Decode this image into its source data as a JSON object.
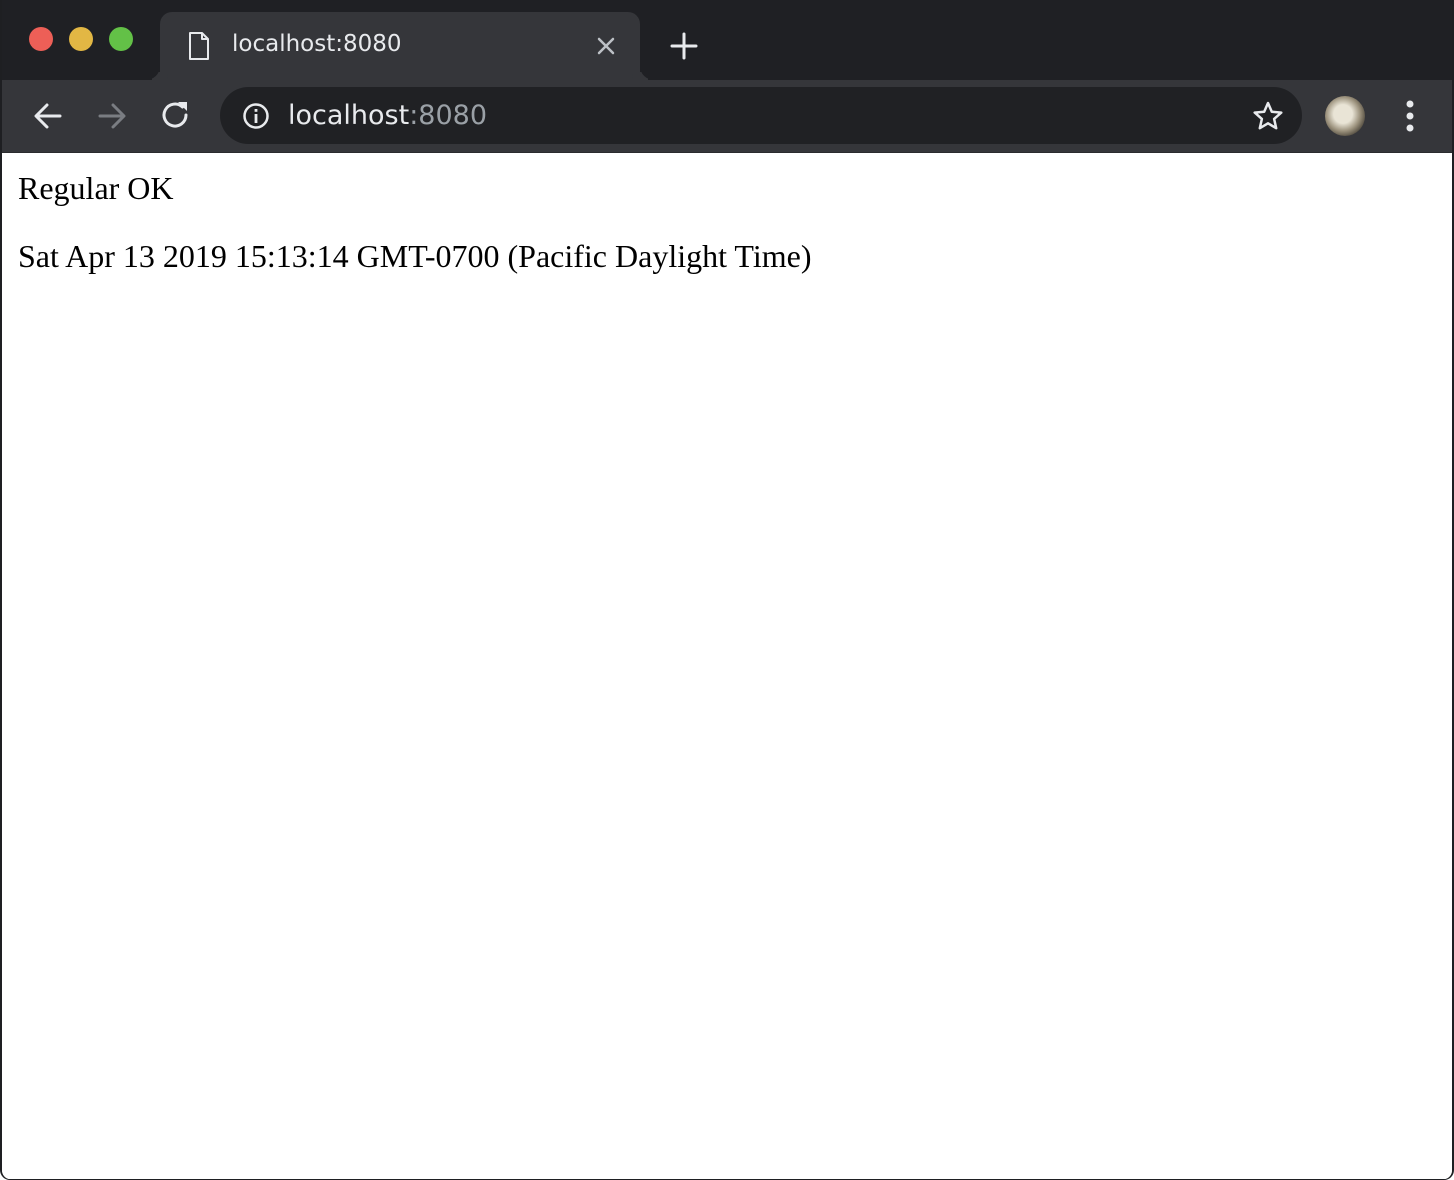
{
  "browser": {
    "tab": {
      "title": "localhost:8080"
    },
    "address_bar": {
      "host": "localhost",
      "port": ":8080"
    },
    "colors": {
      "frame": "#1f2024",
      "toolbar": "#35363a",
      "omnibox": "#202124",
      "close_light": "#ed5f57",
      "minimize_light": "#e2b744",
      "maximize_light": "#63c147"
    },
    "icons": [
      "document-icon",
      "close-icon",
      "plus-icon",
      "back-arrow-icon",
      "forward-arrow-icon",
      "reload-icon",
      "info-icon",
      "star-icon",
      "avatar",
      "kebab-menu-icon"
    ]
  },
  "page": {
    "lines": [
      "Regular OK",
      "Sat Apr 13 2019 15:13:14 GMT-0700 (Pacific Daylight Time)"
    ]
  }
}
